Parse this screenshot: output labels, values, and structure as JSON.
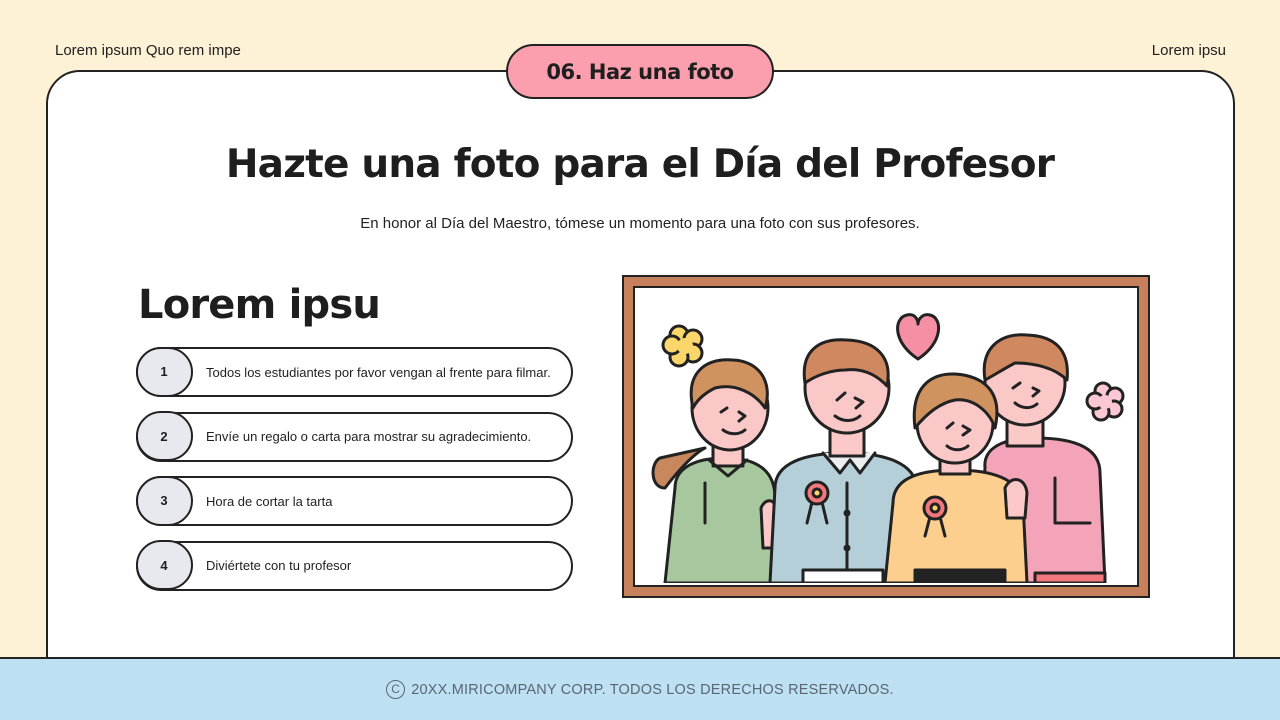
{
  "header": {
    "left_text": "Lorem ipsum Quo rem impe",
    "right_text": "Lorem ipsu",
    "tab_label": "06. Haz una foto"
  },
  "main": {
    "title": "Hazte una foto para el Día del Profesor",
    "subtitle": "En honor al Día del Maestro, tómese un momento para una foto con sus profesores.",
    "list_heading": "Lorem ipsu",
    "items": [
      {
        "number": "1",
        "text": "Todos los estudiantes por favor vengan al frente para filmar."
      },
      {
        "number": "2",
        "text": "Envíe un regalo o carta para mostrar su agradecimiento."
      },
      {
        "number": "3",
        "text": "Hora de cortar la tarta"
      },
      {
        "number": "4",
        "text": "Diviértete con tu profesor"
      }
    ],
    "illustration": {
      "icon": "family-photo-illustration",
      "frame_color": "#c6805c"
    }
  },
  "footer": {
    "icon": "copyright-icon",
    "icon_glyph": "C",
    "text": "20XX.MIRICOMPANY CORP. TODOS LOS DERECHOS RESERVADOS."
  },
  "colors": {
    "background": "#fdf1d6",
    "tab": "#fb9fae",
    "footer": "#bde0f2",
    "number_circle": "#e8e9ee"
  }
}
